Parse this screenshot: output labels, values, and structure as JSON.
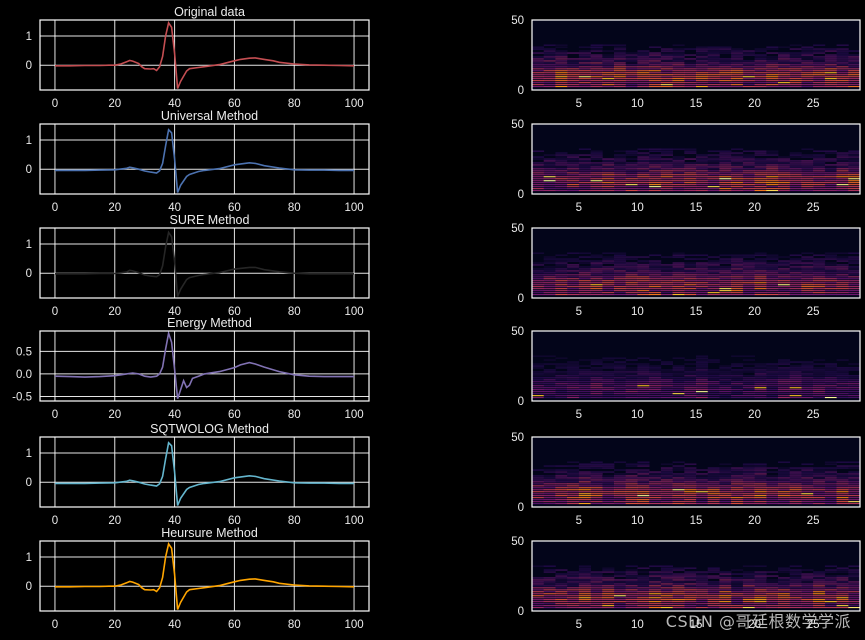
{
  "watermark": "CSDN @哥廷根数学学派",
  "colors": {
    "background": "#000000",
    "axes_frame": "#ffffff",
    "grid": "#ffffff",
    "tick_text": "#eaeaea",
    "spec_bg": "#03051a"
  },
  "chart_data": [
    {
      "type": "line",
      "panel": "left",
      "title": "Original data",
      "color": "#c44e52",
      "xlim": [
        -5,
        105
      ],
      "ylim": [
        -0.85,
        1.55
      ],
      "xticks": [
        0,
        20,
        40,
        60,
        80,
        100
      ],
      "yticks": [
        0,
        1
      ],
      "grid": true,
      "x": [
        0,
        5,
        10,
        15,
        18,
        20,
        22,
        24,
        25,
        26,
        28,
        29,
        30,
        32,
        33,
        34,
        35,
        36,
        37,
        38,
        39,
        40,
        41,
        42,
        44,
        45,
        48,
        50,
        55,
        58,
        60,
        62,
        65,
        67,
        70,
        73,
        75,
        80,
        85,
        90,
        95,
        100
      ],
      "y": [
        -0.02,
        -0.02,
        -0.01,
        -0.01,
        0.0,
        0.0,
        0.04,
        0.12,
        0.16,
        0.14,
        0.06,
        -0.05,
        -0.12,
        -0.13,
        -0.12,
        -0.18,
        -0.05,
        0.3,
        1.0,
        1.45,
        1.3,
        0.4,
        -0.8,
        -0.55,
        -0.2,
        -0.12,
        -0.08,
        -0.05,
        0.02,
        0.1,
        0.15,
        0.2,
        0.24,
        0.25,
        0.2,
        0.15,
        0.1,
        0.04,
        0.01,
        0.0,
        -0.01,
        -0.02
      ]
    },
    {
      "type": "line",
      "panel": "left",
      "title": "Universal Method",
      "color": "#4c72b0",
      "xlim": [
        -5,
        105
      ],
      "ylim": [
        -0.85,
        1.55
      ],
      "xticks": [
        0,
        20,
        40,
        60,
        80,
        100
      ],
      "yticks": [
        0,
        1
      ],
      "grid": true,
      "x": [
        0,
        5,
        10,
        15,
        20,
        24,
        25,
        26,
        28,
        30,
        32,
        34,
        35,
        36,
        37,
        38,
        39,
        40,
        41,
        42,
        44,
        45,
        48,
        50,
        55,
        60,
        65,
        67,
        70,
        75,
        80,
        85,
        90,
        95,
        100
      ],
      "y": [
        -0.04,
        -0.04,
        -0.04,
        -0.03,
        -0.02,
        0.03,
        0.07,
        0.05,
        0.0,
        -0.06,
        -0.1,
        -0.13,
        -0.05,
        0.2,
        0.8,
        1.35,
        1.25,
        0.35,
        -0.8,
        -0.55,
        -0.25,
        -0.18,
        -0.08,
        -0.04,
        0.02,
        0.15,
        0.22,
        0.2,
        0.12,
        0.04,
        -0.02,
        -0.03,
        -0.03,
        -0.04,
        -0.04
      ]
    },
    {
      "type": "line",
      "panel": "left",
      "title": "SURE Method",
      "color": "#262626",
      "xlim": [
        -5,
        105
      ],
      "ylim": [
        -0.85,
        1.55
      ],
      "xticks": [
        0,
        20,
        40,
        60,
        80,
        100
      ],
      "yticks": [
        0,
        1
      ],
      "grid": true,
      "x": [
        0,
        5,
        10,
        15,
        20,
        24,
        25,
        26,
        28,
        30,
        32,
        34,
        35,
        36,
        37,
        38,
        39,
        40,
        41,
        42,
        44,
        45,
        48,
        50,
        55,
        60,
        65,
        67,
        70,
        75,
        80,
        85,
        90,
        95,
        100
      ],
      "y": [
        -0.02,
        -0.02,
        -0.02,
        -0.01,
        -0.01,
        0.04,
        0.1,
        0.08,
        0.02,
        -0.06,
        -0.1,
        -0.12,
        -0.05,
        0.25,
        0.9,
        1.4,
        1.25,
        0.4,
        -0.8,
        -0.55,
        -0.22,
        -0.15,
        -0.08,
        -0.04,
        0.02,
        0.14,
        0.2,
        0.2,
        0.12,
        0.05,
        0.0,
        -0.02,
        -0.02,
        -0.02,
        -0.02
      ]
    },
    {
      "type": "line",
      "panel": "left",
      "title": "Energy Method",
      "color": "#8172b3",
      "xlim": [
        -5,
        105
      ],
      "ylim": [
        -0.6,
        0.95
      ],
      "xticks": [
        0,
        20,
        40,
        60,
        80,
        100
      ],
      "yticks": [
        -0.5,
        0.0,
        0.5
      ],
      "ytick_labels": [
        "-0.5",
        "0.0",
        "0.5"
      ],
      "grid": true,
      "x": [
        0,
        5,
        10,
        15,
        20,
        24,
        26,
        28,
        30,
        32,
        34,
        35,
        36,
        37,
        38,
        39,
        40,
        41,
        42,
        43,
        44,
        45,
        46,
        48,
        50,
        55,
        60,
        62,
        65,
        67,
        70,
        75,
        80,
        85,
        90,
        95,
        100
      ],
      "y": [
        -0.05,
        -0.06,
        -0.07,
        -0.06,
        -0.04,
        0.0,
        0.02,
        0.0,
        -0.05,
        -0.07,
        -0.05,
        0.0,
        0.15,
        0.55,
        0.9,
        0.7,
        0.1,
        -0.55,
        -0.35,
        -0.15,
        -0.3,
        -0.25,
        -0.1,
        -0.05,
        0.0,
        0.05,
        0.14,
        0.2,
        0.25,
        0.22,
        0.15,
        0.05,
        -0.02,
        -0.05,
        -0.06,
        -0.06,
        -0.06
      ]
    },
    {
      "type": "line",
      "panel": "left",
      "title": "SQTWOLOG Method",
      "color": "#64b5cd",
      "xlim": [
        -5,
        105
      ],
      "ylim": [
        -0.85,
        1.55
      ],
      "xticks": [
        0,
        20,
        40,
        60,
        80,
        100
      ],
      "yticks": [
        0,
        1
      ],
      "grid": true,
      "x": [
        0,
        5,
        10,
        15,
        20,
        24,
        25,
        26,
        28,
        30,
        32,
        34,
        35,
        36,
        37,
        38,
        39,
        40,
        41,
        42,
        44,
        45,
        48,
        50,
        55,
        60,
        65,
        67,
        70,
        75,
        80,
        85,
        90,
        95,
        100
      ],
      "y": [
        -0.04,
        -0.04,
        -0.04,
        -0.03,
        -0.02,
        0.03,
        0.07,
        0.05,
        0.0,
        -0.06,
        -0.1,
        -0.13,
        -0.05,
        0.2,
        0.8,
        1.35,
        1.25,
        0.35,
        -0.8,
        -0.55,
        -0.25,
        -0.18,
        -0.08,
        -0.04,
        0.02,
        0.15,
        0.22,
        0.2,
        0.12,
        0.04,
        -0.02,
        -0.03,
        -0.03,
        -0.04,
        -0.04
      ]
    },
    {
      "type": "line",
      "panel": "left",
      "title": "Heursure Method",
      "color": "#ffa500",
      "xlim": [
        -5,
        105
      ],
      "ylim": [
        -0.85,
        1.55
      ],
      "xticks": [
        0,
        20,
        40,
        60,
        80,
        100
      ],
      "yticks": [
        0,
        1
      ],
      "grid": true,
      "x": [
        0,
        5,
        10,
        15,
        18,
        20,
        22,
        24,
        25,
        26,
        28,
        29,
        30,
        32,
        33,
        34,
        35,
        36,
        37,
        38,
        39,
        40,
        41,
        42,
        44,
        45,
        48,
        50,
        55,
        58,
        60,
        62,
        65,
        67,
        70,
        73,
        75,
        80,
        85,
        90,
        95,
        100
      ],
      "y": [
        -0.02,
        -0.02,
        -0.01,
        -0.01,
        0.0,
        0.0,
        0.04,
        0.12,
        0.16,
        0.14,
        0.06,
        -0.05,
        -0.12,
        -0.13,
        -0.12,
        -0.18,
        -0.05,
        0.3,
        1.0,
        1.45,
        1.3,
        0.4,
        -0.8,
        -0.55,
        -0.2,
        -0.12,
        -0.08,
        -0.05,
        0.02,
        0.1,
        0.15,
        0.2,
        0.24,
        0.25,
        0.2,
        0.15,
        0.1,
        0.04,
        0.01,
        0.0,
        -0.01,
        -0.02
      ]
    },
    {
      "type": "heatmap",
      "panel": "right",
      "xlim": [
        1,
        29
      ],
      "ylim": [
        0,
        50
      ],
      "xticks": [
        5,
        10,
        15,
        20,
        25
      ],
      "yticks": [
        0,
        50
      ],
      "grid": false,
      "seed": 11,
      "intensity": 1.0
    },
    {
      "type": "heatmap",
      "panel": "right",
      "xlim": [
        1,
        29
      ],
      "ylim": [
        0,
        50
      ],
      "xticks": [
        5,
        10,
        15,
        20,
        25
      ],
      "yticks": [
        0,
        50
      ],
      "grid": false,
      "seed": 23,
      "intensity": 0.95
    },
    {
      "type": "heatmap",
      "panel": "right",
      "xlim": [
        1,
        29
      ],
      "ylim": [
        0,
        50
      ],
      "xticks": [
        5,
        10,
        15,
        20,
        25
      ],
      "yticks": [
        0,
        50
      ],
      "grid": false,
      "seed": 37,
      "intensity": 0.9
    },
    {
      "type": "heatmap",
      "panel": "right",
      "xlim": [
        1,
        29
      ],
      "ylim": [
        0,
        50
      ],
      "xticks": [
        5,
        10,
        15,
        20,
        25
      ],
      "yticks": [
        0,
        50
      ],
      "grid": false,
      "seed": 41,
      "intensity": 0.55
    },
    {
      "type": "heatmap",
      "panel": "right",
      "xlim": [
        1,
        29
      ],
      "ylim": [
        0,
        50
      ],
      "xticks": [
        5,
        10,
        15,
        20,
        25
      ],
      "yticks": [
        0,
        50
      ],
      "grid": false,
      "seed": 53,
      "intensity": 0.95
    },
    {
      "type": "heatmap",
      "panel": "right",
      "xlim": [
        1,
        29
      ],
      "ylim": [
        0,
        50
      ],
      "xticks": [
        5,
        10,
        15,
        20,
        25
      ],
      "yticks": [
        0,
        50
      ],
      "grid": false,
      "seed": 67,
      "intensity": 1.0
    }
  ]
}
